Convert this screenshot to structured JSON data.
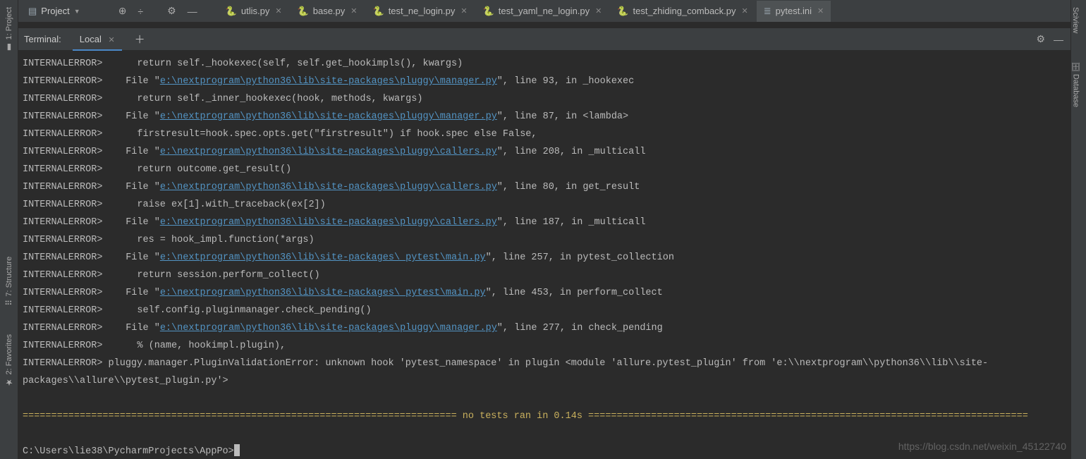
{
  "project_label": "Project",
  "left_tools": [
    {
      "label": "1: Project",
      "name": "tool-project"
    },
    {
      "label": "7: Structure",
      "name": "tool-structure"
    },
    {
      "label": "2: Favorites",
      "name": "tool-favorites"
    }
  ],
  "right_tools": [
    {
      "label": "Sciview",
      "name": "tool-sciview"
    },
    {
      "label": "Database",
      "name": "tool-database"
    }
  ],
  "file_tabs": [
    {
      "label": "utlis.py",
      "type": "py",
      "active": false
    },
    {
      "label": "base.py",
      "type": "py",
      "active": false
    },
    {
      "label": "test_ne_login.py",
      "type": "py",
      "active": false
    },
    {
      "label": "test_yaml_ne_login.py",
      "type": "py",
      "active": false
    },
    {
      "label": "test_zhiding_comback.py",
      "type": "py",
      "active": false
    },
    {
      "label": "pytest.ini",
      "type": "ini",
      "active": true
    }
  ],
  "terminal_title": "Terminal:",
  "terminal_tab": "Local",
  "trace": {
    "tag": "INTERNALERROR>",
    "lines": [
      {
        "kind": "code",
        "text": "    return self._hookexec(self, self.get_hookimpls(), kwargs)"
      },
      {
        "kind": "file",
        "pre": "  File \"",
        "link": "e:\\nextprogram\\python36\\lib\\site-packages\\pluggy\\manager.py",
        "post": "\", line 93, in _hookexec"
      },
      {
        "kind": "code",
        "text": "    return self._inner_hookexec(hook, methods, kwargs)"
      },
      {
        "kind": "file",
        "pre": "  File \"",
        "link": "e:\\nextprogram\\python36\\lib\\site-packages\\pluggy\\manager.py",
        "post": "\", line 87, in <lambda>"
      },
      {
        "kind": "code",
        "text": "    firstresult=hook.spec.opts.get(\"firstresult\") if hook.spec else False,"
      },
      {
        "kind": "file",
        "pre": "  File \"",
        "link": "e:\\nextprogram\\python36\\lib\\site-packages\\pluggy\\callers.py",
        "post": "\", line 208, in _multicall"
      },
      {
        "kind": "code",
        "text": "    return outcome.get_result()"
      },
      {
        "kind": "file",
        "pre": "  File \"",
        "link": "e:\\nextprogram\\python36\\lib\\site-packages\\pluggy\\callers.py",
        "post": "\", line 80, in get_result"
      },
      {
        "kind": "code",
        "text": "    raise ex[1].with_traceback(ex[2])"
      },
      {
        "kind": "file",
        "pre": "  File \"",
        "link": "e:\\nextprogram\\python36\\lib\\site-packages\\pluggy\\callers.py",
        "post": "\", line 187, in _multicall"
      },
      {
        "kind": "code",
        "text": "    res = hook_impl.function(*args)"
      },
      {
        "kind": "file",
        "pre": "  File \"",
        "link": "e:\\nextprogram\\python36\\lib\\site-packages\\_pytest\\main.py",
        "post": "\", line 257, in pytest_collection"
      },
      {
        "kind": "code",
        "text": "    return session.perform_collect()"
      },
      {
        "kind": "file",
        "pre": "  File \"",
        "link": "e:\\nextprogram\\python36\\lib\\site-packages\\_pytest\\main.py",
        "post": "\", line 453, in perform_collect"
      },
      {
        "kind": "code",
        "text": "    self.config.pluginmanager.check_pending()"
      },
      {
        "kind": "file",
        "pre": "  File \"",
        "link": "e:\\nextprogram\\python36\\lib\\site-packages\\pluggy\\manager.py",
        "post": "\", line 277, in check_pending"
      },
      {
        "kind": "code",
        "text": "    % (name, hookimpl.plugin),"
      }
    ],
    "final1": "INTERNALERROR> pluggy.manager.PluginValidationError: unknown hook 'pytest_namespace' in plugin <module 'allure.pytest_plugin' from 'e:\\\\nextprogram\\\\python36\\\\lib\\\\site-",
    "final2": "packages\\\\allure\\\\pytest_plugin.py'>"
  },
  "summary": "============================================================================ no tests ran in 0.14s =============================================================================",
  "prompt": "C:\\Users\\lie38\\PycharmProjects\\AppPo>",
  "watermark": "https://blog.csdn.net/weixin_45122740"
}
